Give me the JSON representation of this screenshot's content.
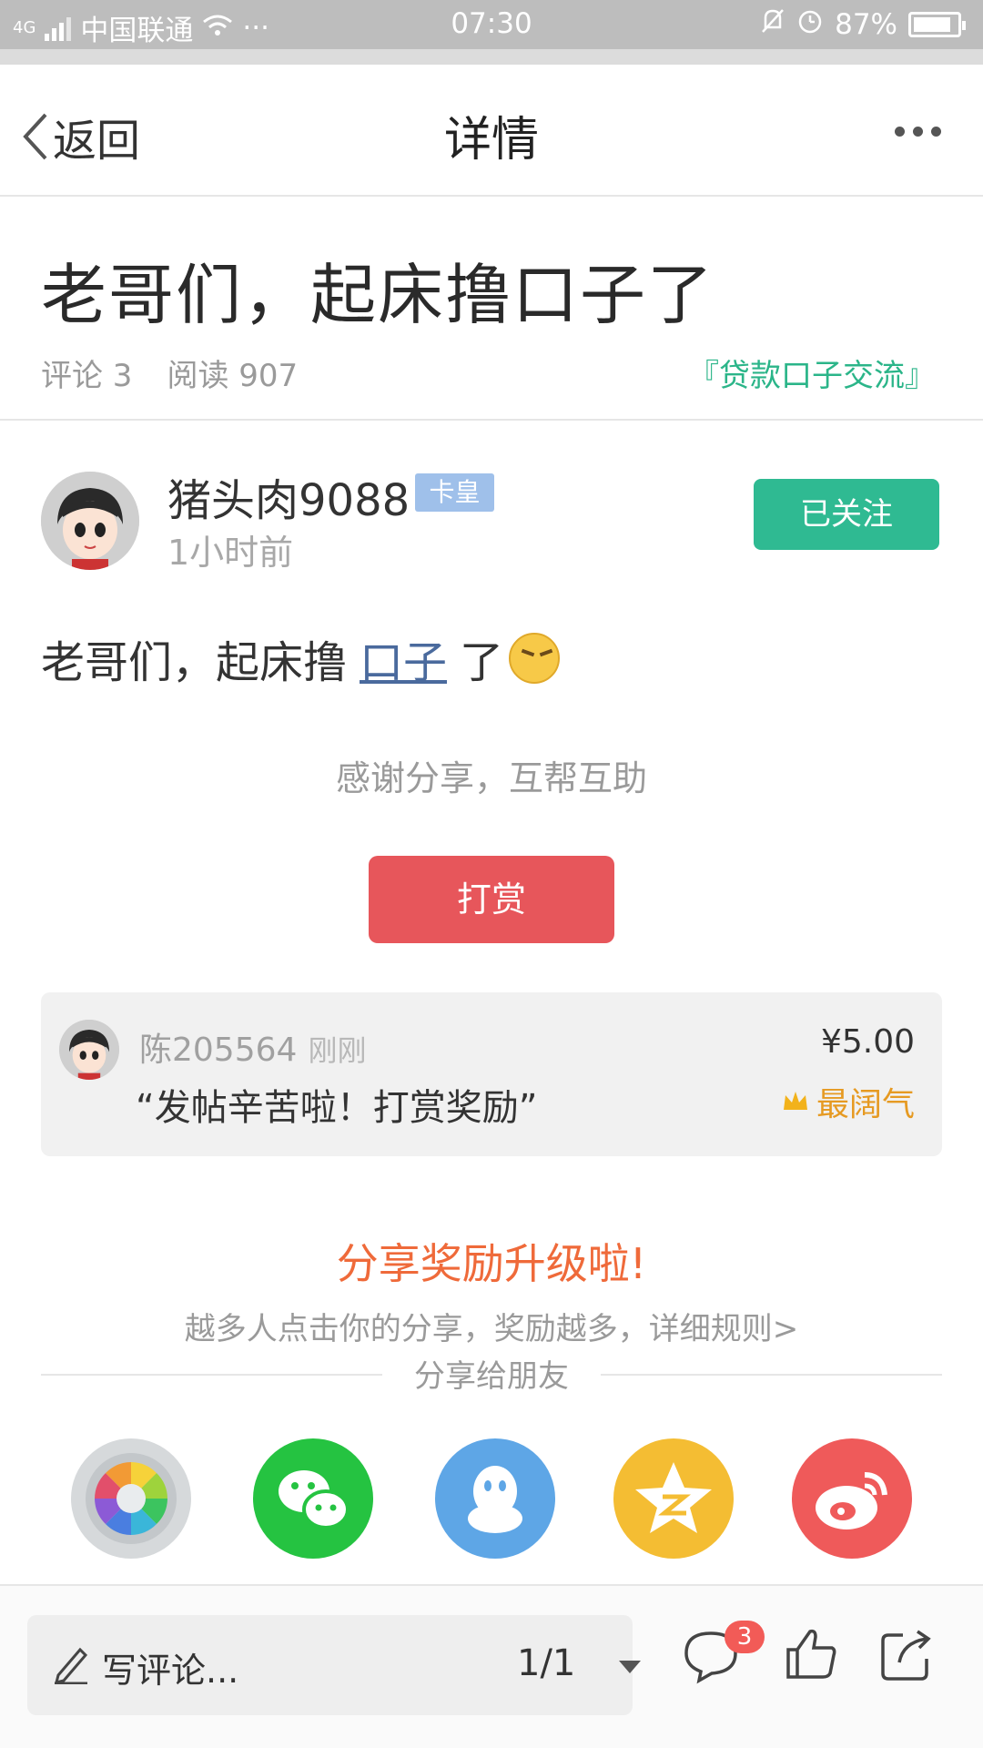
{
  "status_bar": {
    "network": "4G",
    "carrier": "中国联通",
    "dots": "···",
    "time": "07:30",
    "battery": "87%",
    "battery_level": 0.87
  },
  "nav": {
    "back_label": "返回",
    "title": "详情"
  },
  "post": {
    "title": "老哥们，起床撸口子了",
    "comments_label": "评论 3",
    "reads_label": "阅读 907",
    "category": "『贷款口子交流』",
    "body_prefix": "老哥们，起床撸",
    "body_link": "口子",
    "body_suffix": "了"
  },
  "author": {
    "name": "猪头肉9088",
    "badge": "卡皇",
    "time": "1小时前",
    "follow_label": "已关注"
  },
  "reward": {
    "thanks": "感谢分享，互帮互助",
    "button_label": "打赏",
    "record": {
      "user": "陈205564",
      "time": "刚刚",
      "message": "“发帖辛苦啦！打赏奖励”",
      "amount": "¥5.00",
      "tag": "最阔气"
    }
  },
  "share": {
    "title": "分享奖励升级啦!",
    "desc": "越多人点击你的分享，奖励越多，详细规则>",
    "to_label": "分享给朋友",
    "icons": [
      "moments-icon",
      "wechat-icon",
      "qq-icon",
      "qzone-icon",
      "weibo-icon"
    ]
  },
  "bottom_bar": {
    "comment_placeholder": "写评论...",
    "pages": "1/1",
    "comment_count": "3"
  },
  "colors": {
    "accent_green": "#2fba92",
    "reward_red": "#e7565b",
    "share_orange": "#ef6a3a",
    "link_blue": "#4a6a9d",
    "badge_blue": "#9fc0ea"
  }
}
